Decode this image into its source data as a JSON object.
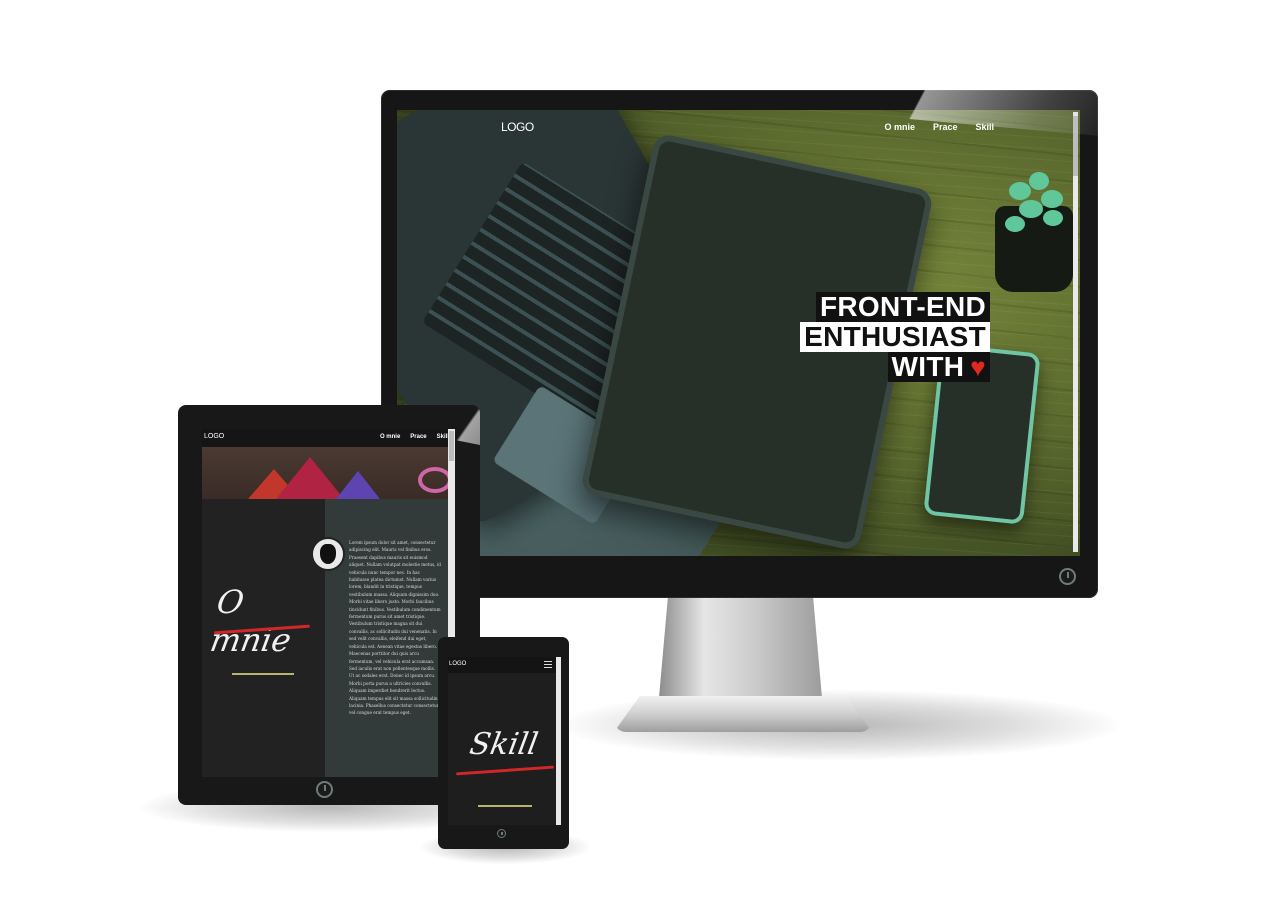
{
  "monitor": {
    "site_logo": "LOGO",
    "nav": [
      "O mnie",
      "Prace",
      "Skill"
    ],
    "hero": {
      "line1": "FRONT-END",
      "line2": "ENTHUSIAST",
      "line3": "WITH"
    },
    "heart_icon": "heart-icon"
  },
  "tablet": {
    "site_logo": "LOGO",
    "nav": [
      "O mnie",
      "Prace",
      "Skill"
    ],
    "section_title": "O mnie",
    "body_text": "Lorem ipsum dolor sit amet, consectetur adipiscing elit. Mauris vel finibus eros. Praesent dapibus mauris sit euismod aliquet. Nullam volutpat molestie metus, id vehicula nunc tempor nec. In hac habitasse platea dictumst. Nullam varius lorem, blandit in tristique, tempus vestibulum massa. Aliquam dignissim duo. Morbi vitae libero justo. Morbi faucibus tincidunt finibus. Vestibulum condimentum fermentum purus sit amet tristique. Vestibulum tristique magna sit dui convallis, ac sollicitudin dui venenatis. In sed velit convallis, eleifend dui eget, vehicula est. Aenean vitae egestas libero. Maecenas porttitor dui quis arcu fermentum, vel vehicula erat accumsan. Sed iaculis erat non pellentesque mollis. Ut ac sodales erat. Donec id ipsum arcu. Morbi porta purus a ultricies convallis. Aliquam imperdiet hendrerit lectus. Aliquam tempus elit sit massa sollicitudin lacinia. Phasellus consectetur consectetur, vel congue erat tempus eget."
  },
  "phone": {
    "site_logo": "LOGO",
    "section_title": "Skill"
  }
}
